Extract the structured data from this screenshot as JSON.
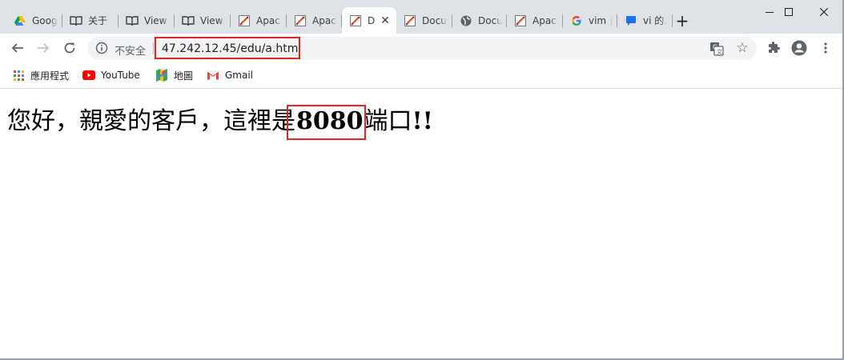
{
  "browser": {
    "tabs": [
      {
        "title": "Goog",
        "icon": "google-drive-icon",
        "active": false
      },
      {
        "title": "关于",
        "icon": "book-icon",
        "active": false
      },
      {
        "title": "View",
        "icon": "book-icon",
        "active": false
      },
      {
        "title": "View",
        "icon": "book-icon",
        "active": false
      },
      {
        "title": "Apac",
        "icon": "apache-feather-icon",
        "active": false
      },
      {
        "title": "Apac",
        "icon": "apache-feather-icon",
        "active": false
      },
      {
        "title": "D",
        "icon": "apache-feather-icon",
        "active": true
      },
      {
        "title": "Docu",
        "icon": "apache-feather-icon",
        "active": false
      },
      {
        "title": "Docu",
        "icon": "globe-icon",
        "active": false
      },
      {
        "title": "Apac",
        "icon": "apache-feather-icon",
        "active": false
      },
      {
        "title": "vim 自",
        "icon": "google-g-icon",
        "active": false
      },
      {
        "title": "vi 的…",
        "icon": "chat-bubble-icon",
        "active": false
      }
    ],
    "new_tab_label": "+",
    "close_glyph": "✕",
    "window_controls": {
      "minimize": "minimize-icon",
      "maximize": "maximize-icon",
      "close": "window-close-icon"
    }
  },
  "toolbar": {
    "security_label": "不安全",
    "url": "47.242.12.45/edu/a.html"
  },
  "bookmarks": [
    {
      "label": "應用程式",
      "icon": "apps-grid-icon"
    },
    {
      "label": "YouTube",
      "icon": "youtube-icon"
    },
    {
      "label": "地圖",
      "icon": "maps-icon"
    },
    {
      "label": "Gmail",
      "icon": "gmail-icon"
    }
  ],
  "page": {
    "greeting": "您好，親愛的客戶，這裡是",
    "port": "8080",
    "suffix_zh": "端口",
    "suffix_marks": "!!"
  },
  "colors": {
    "highlight_box": "#e8231c",
    "tabstrip": "#dee1e6",
    "omnibox": "#f1f3f4"
  }
}
